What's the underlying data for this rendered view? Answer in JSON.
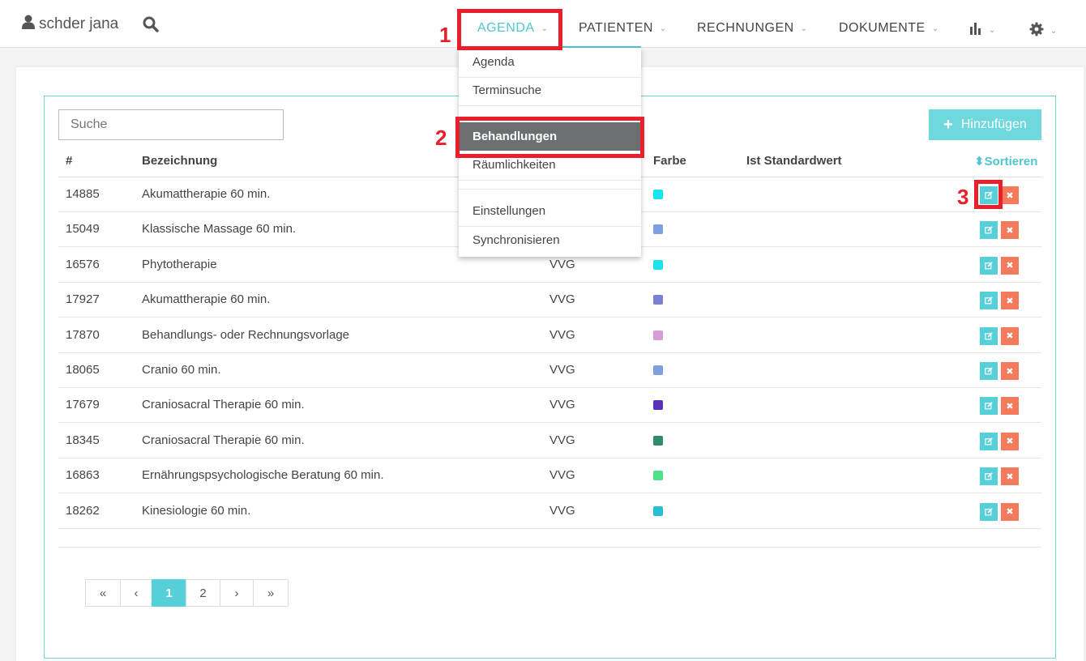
{
  "header": {
    "user_name": "schder jana",
    "nav": {
      "agenda": "AGENDA",
      "patienten": "PATIENTEN",
      "rechnungen": "RECHNUNGEN",
      "dokumente": "DOKUMENTE"
    },
    "icons": [
      "user-icon",
      "search-icon",
      "chart-icon",
      "gear-icon"
    ]
  },
  "dropdown": {
    "items": [
      "Agenda",
      "Terminsuche",
      "Behandlungen",
      "Räumlichkeiten",
      "Einstellungen",
      "Synchronisieren"
    ],
    "active": "Behandlungen"
  },
  "annotations": [
    "1",
    "2",
    "3"
  ],
  "toolbar": {
    "search_placeholder": "Suche",
    "add_label": "Hinzufügen"
  },
  "table": {
    "columns": [
      "#",
      "Bezeichnung",
      "Farbe",
      "Ist Standardwert"
    ],
    "sort_label": "Sortieren",
    "rows": [
      {
        "id": "14885",
        "name": "Akumattherapie 60 min.",
        "type": "",
        "color": "#19e3ee"
      },
      {
        "id": "15049",
        "name": "Klassische Massage 60 min.",
        "type": "",
        "color": "#7f9fe0"
      },
      {
        "id": "16576",
        "name": "Phytotherapie",
        "type": "VVG",
        "color": "#19e3ee"
      },
      {
        "id": "17927",
        "name": "Akumattherapie 60 min.",
        "type": "VVG",
        "color": "#7a80d3"
      },
      {
        "id": "17870",
        "name": "Behandlungs- oder Rechnungsvorlage",
        "type": "VVG",
        "color": "#d79bd6"
      },
      {
        "id": "18065",
        "name": "Cranio 60 min.",
        "type": "VVG",
        "color": "#7f9fe0"
      },
      {
        "id": "17679",
        "name": "Craniosacral Therapie 60 min.",
        "type": "VVG",
        "color": "#5a31b8"
      },
      {
        "id": "18345",
        "name": "Craniosacral Therapie 60 min.",
        "type": "VVG",
        "color": "#2e8a6b"
      },
      {
        "id": "16863",
        "name": "Ernährungspsychologische Beratung 60 min.",
        "type": "VVG",
        "color": "#4fe08a"
      },
      {
        "id": "18262",
        "name": "Kinesiologie 60 min.",
        "type": "VVG",
        "color": "#27bfd2"
      }
    ]
  },
  "pagination": {
    "first": "«",
    "prev": "‹",
    "pages": [
      "1",
      "2"
    ],
    "current": "1",
    "next": "›",
    "last": "»"
  }
}
